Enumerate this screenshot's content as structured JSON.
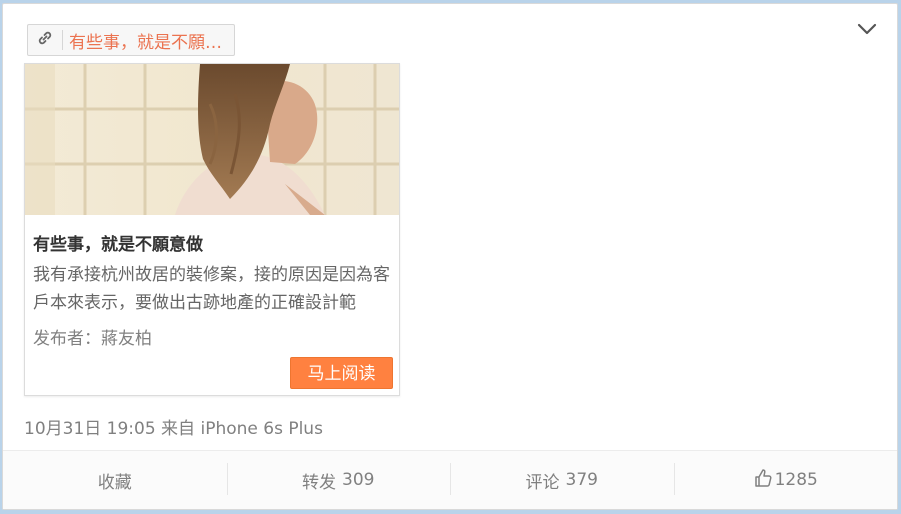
{
  "post": {
    "link_label": "有些事，就是不願…",
    "article": {
      "title": "有些事，就是不願意做",
      "description": "我有承接杭州故居的裝修案，接的原因是因為客戶本來表示，要做出古跡地產的正確設計範",
      "author": "发布者：蔣友柏",
      "read_button": "马上阅读"
    },
    "meta": "10月31日 19:05 来自 iPhone 6s Plus"
  },
  "actions": {
    "favorite": "收藏",
    "repost_label": "转发",
    "repost_count": "309",
    "comment_label": "评论",
    "comment_count": "379",
    "like_count": "1285"
  },
  "icons": {
    "chevron": "chevron-down-icon",
    "link": "link-icon",
    "like": "thumbs-up-icon"
  },
  "colors": {
    "accent": "#eb7350",
    "button": "#ff8140",
    "muted": "#808080"
  }
}
